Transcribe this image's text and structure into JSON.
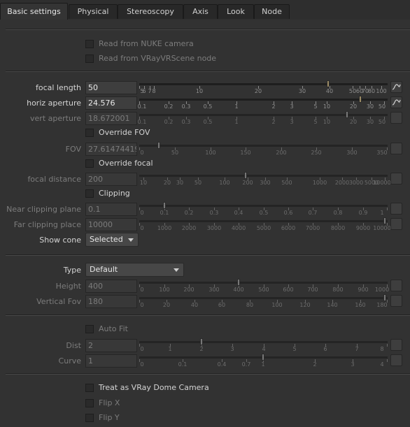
{
  "tabs": [
    "Basic settings",
    "Physical",
    "Stereoscopy",
    "Axis",
    "Look",
    "Node"
  ],
  "checkboxes": {
    "read_nuke": "Read from NUKE camera",
    "read_vrscene": "Read from VRayVRScene node",
    "override_fov": "Override FOV",
    "override_focal": "Override focal",
    "clipping": "Clipping",
    "auto_fit": "Auto Fit",
    "dome": "Treat as VRay Dome Camera",
    "flip_x": "Flip X",
    "flip_y": "Flip Y"
  },
  "params": {
    "focal_length": {
      "label": "focal length",
      "value": "50",
      "level": "50"
    },
    "horiz_aperture": {
      "label": "horiz aperture",
      "value": "24.576",
      "level": "24.576"
    },
    "vert_aperture": {
      "label": "vert aperture",
      "value": "18.672001",
      "level": "18.672001"
    },
    "fov": {
      "label": "FOV",
      "value": "27.61474419",
      "level": "27.6"
    },
    "focal_distance": {
      "label": "focal distance",
      "value": "200",
      "level": "200"
    },
    "near_clip": {
      "label": "Near clipping plane",
      "value": "0.1",
      "level": "0.1"
    },
    "far_clip": {
      "label": "Far clipping place",
      "value": "10000",
      "level": "10000"
    },
    "height": {
      "label": "Height",
      "value": "400",
      "level": "400"
    },
    "vertical_fov": {
      "label": "Vertical Fov",
      "value": "180",
      "level": "180"
    },
    "dist": {
      "label": "Dist",
      "value": "2",
      "level": "2"
    },
    "curve": {
      "label": "Curve",
      "value": "1",
      "level": "1"
    }
  },
  "show_cone": {
    "label": "Show cone",
    "value": "Selected"
  },
  "type": {
    "label": "Type",
    "value": "Default"
  },
  "scales": {
    "focal_length": [
      "5",
      "6",
      "7",
      "8",
      "10",
      "20",
      "30",
      "40",
      "50",
      "60",
      "70",
      "80",
      "100"
    ],
    "horiz_aperture": [
      "0.1",
      "0.2",
      "0.3",
      "0.5",
      "1",
      "2",
      "3",
      "5",
      "10",
      "20",
      "30",
      "50"
    ],
    "vert_aperture": [
      "0.1",
      "0.2",
      "0.3",
      "0.5",
      "1",
      "2",
      "3",
      "5",
      "10",
      "20",
      "30",
      "50"
    ],
    "fov": [
      "0",
      "50",
      "100",
      "150",
      "200",
      "250",
      "300",
      "350"
    ],
    "focal_distance": [
      "10",
      "20",
      "30",
      "50",
      "100",
      "200",
      "300",
      "500",
      "1000",
      "2000",
      "3000",
      "5000",
      "10000"
    ],
    "near_clip": [
      "0",
      "0.1",
      "0.2",
      "0.3",
      "0.4",
      "0.5",
      "0.6",
      "0.7",
      "0.8",
      "0.9",
      "1"
    ],
    "far_clip": [
      "0",
      "1000",
      "2000",
      "3000",
      "4000",
      "5000",
      "6000",
      "7000",
      "8000",
      "9000",
      "10000"
    ],
    "height": [
      "0",
      "100",
      "200",
      "300",
      "400",
      "500",
      "600",
      "700",
      "800",
      "900",
      "1000"
    ],
    "vertical_fov": [
      "0",
      "20",
      "40",
      "60",
      "80",
      "100",
      "120",
      "140",
      "160",
      "180"
    ],
    "dist": [
      "0",
      "1",
      "2",
      "3",
      "4",
      "5",
      "6",
      "7",
      "8"
    ],
    "curve": [
      "0",
      "0.1",
      "0.4",
      "0.7",
      "1",
      "2",
      "3",
      "4"
    ]
  },
  "colors": {
    "accent": "#9a8a64",
    "bg": "#323232",
    "disabled_text": "#7c7c7c"
  },
  "icons": {
    "anim_curve": "curve-icon"
  }
}
